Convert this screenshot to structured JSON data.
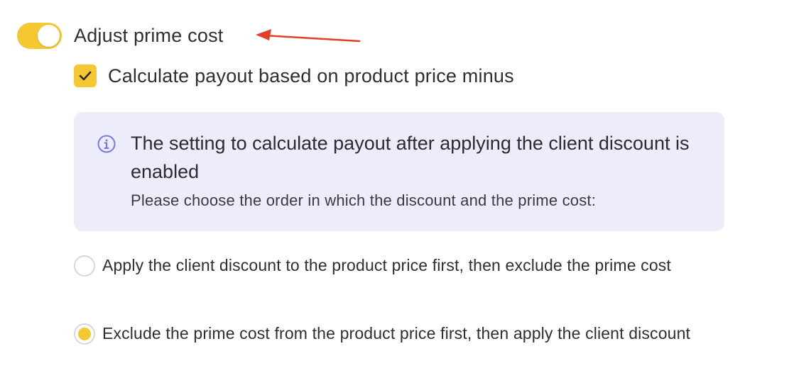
{
  "toggle": {
    "label": "Adjust prime cost",
    "on": true
  },
  "checkbox": {
    "label": "Calculate payout based on product price minus",
    "checked": true
  },
  "info": {
    "icon": "info-icon",
    "title": "The setting to calculate payout after applying the client discount is enabled",
    "text": "Please choose the order in which the discount and the prime cost:"
  },
  "options": [
    {
      "label": "Apply the client discount to the product price first, then exclude the prime cost",
      "selected": false
    },
    {
      "label": "Exclude the prime cost from the product price first, then apply the client discount",
      "selected": true
    }
  ],
  "colors": {
    "accent": "#f5c731",
    "info_bg": "#ececfb",
    "info_icon": "#7a78e0",
    "arrow": "#e0402a"
  }
}
